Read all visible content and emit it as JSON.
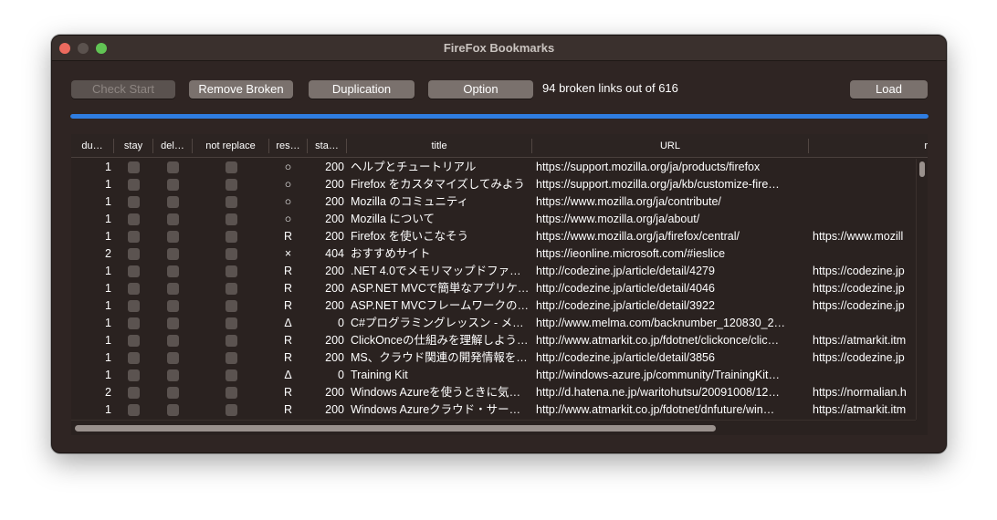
{
  "window": {
    "title": "FireFox Bookmarks"
  },
  "toolbar": {
    "check_start": "Check Start",
    "remove_broken": "Remove Broken",
    "duplication": "Duplication",
    "option": "Option",
    "status": "94 broken links out of 616",
    "load": "Load"
  },
  "progress": {
    "percent": 100,
    "color": "#2f7de1"
  },
  "table": {
    "columns": [
      "du…",
      "stay",
      "del…",
      "not replace",
      "res…",
      "sta…",
      "title",
      "URL",
      "r"
    ],
    "rows": [
      {
        "dup": "1",
        "result": "○",
        "status": "200",
        "title": "ヘルプとチュートリアル",
        "url": "https://support.mozilla.org/ja/products/firefox",
        "replace": ""
      },
      {
        "dup": "1",
        "result": "○",
        "status": "200",
        "title": "Firefox をカスタマイズしてみよう",
        "url": "https://support.mozilla.org/ja/kb/customize-fire…",
        "replace": ""
      },
      {
        "dup": "1",
        "result": "○",
        "status": "200",
        "title": "Mozilla のコミュニティ",
        "url": "https://www.mozilla.org/ja/contribute/",
        "replace": ""
      },
      {
        "dup": "1",
        "result": "○",
        "status": "200",
        "title": "Mozilla について",
        "url": "https://www.mozilla.org/ja/about/",
        "replace": ""
      },
      {
        "dup": "1",
        "result": "R",
        "status": "200",
        "title": "Firefox を使いこなそう",
        "url": "https://www.mozilla.org/ja/firefox/central/",
        "replace": "https://www.mozill"
      },
      {
        "dup": "2",
        "result": "×",
        "status": "404",
        "title": "おすすめサイト",
        "url": "https://ieonline.microsoft.com/#ieslice",
        "replace": ""
      },
      {
        "dup": "1",
        "result": "R",
        "status": "200",
        "title": ".NET 4.0でメモリマップドファ…",
        "url": "http://codezine.jp/article/detail/4279",
        "replace": "https://codezine.jp"
      },
      {
        "dup": "1",
        "result": "R",
        "status": "200",
        "title": "ASP.NET MVCで簡単なアプリケ…",
        "url": "http://codezine.jp/article/detail/4046",
        "replace": "https://codezine.jp"
      },
      {
        "dup": "1",
        "result": "R",
        "status": "200",
        "title": "ASP.NET MVCフレームワークの…",
        "url": "http://codezine.jp/article/detail/3922",
        "replace": "https://codezine.jp"
      },
      {
        "dup": "1",
        "result": "Δ",
        "status": "0",
        "title": "C#プログラミングレッスン - メ…",
        "url": "http://www.melma.com/backnumber_120830_2…",
        "replace": ""
      },
      {
        "dup": "1",
        "result": "R",
        "status": "200",
        "title": "ClickOnceの仕組みを理解しよう…",
        "url": "http://www.atmarkit.co.jp/fdotnet/clickonce/clic…",
        "replace": "https://atmarkit.itm"
      },
      {
        "dup": "1",
        "result": "R",
        "status": "200",
        "title": "MS、クラウド関連の開発情報を…",
        "url": "http://codezine.jp/article/detail/3856",
        "replace": "https://codezine.jp"
      },
      {
        "dup": "1",
        "result": "Δ",
        "status": "0",
        "title": "Training Kit",
        "url": "http://windows-azure.jp/community/TrainingKit…",
        "replace": ""
      },
      {
        "dup": "2",
        "result": "R",
        "status": "200",
        "title": "Windows Azureを使うときに気…",
        "url": "http://d.hatena.ne.jp/waritohutsu/20091008/12…",
        "replace": "https://normalian.h"
      },
      {
        "dup": "1",
        "result": "R",
        "status": "200",
        "title": "Windows Azureクラウド・サー…",
        "url": "http://www.atmarkit.co.jp/fdotnet/dnfuture/win…",
        "replace": "https://atmarkit.itm"
      }
    ]
  }
}
